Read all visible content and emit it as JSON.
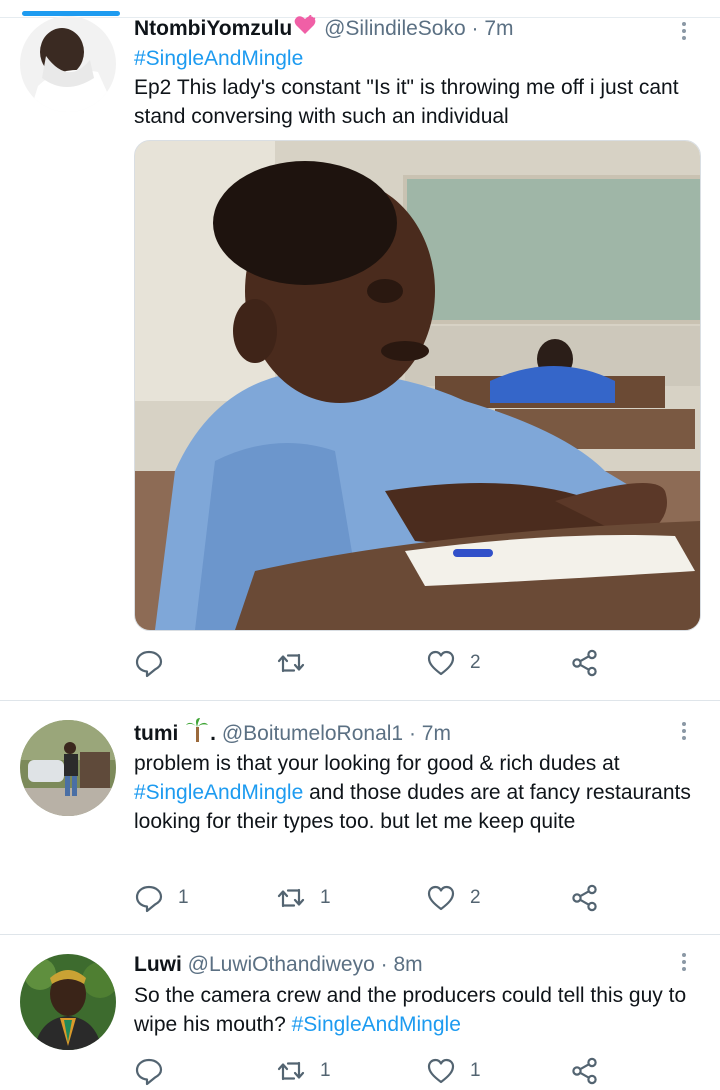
{
  "colors": {
    "accent": "#1d9bf0",
    "text": "#0f1419",
    "muted": "#536471"
  },
  "tweets": [
    {
      "name": "NtombiYomzulu",
      "name_emoji": "pink-heart-icon",
      "handle": "@SilindileSoko",
      "time": "7m",
      "hashtag_line": "#SingleAndMingle",
      "text": "Ep2 This lady's constant \"Is it\" is throwing me off i just cant stand conversing with such an individual",
      "media": "photo of a boy in a blue school shirt at a classroom desk",
      "reply_count": "",
      "retweet_count": "",
      "like_count": "2"
    },
    {
      "name": "tumi",
      "name_emoji": "palm-tree-icon",
      "name_suffix": ".",
      "handle": "@BoitumeloRonal1",
      "time": "7m",
      "text_before": "problem is that your looking for good & rich dudes at ",
      "hashtag": "#SingleAndMingle",
      "text_after": " and those dudes are at fancy restaurants looking for their types too. but let me keep quite",
      "reply_count": "1",
      "retweet_count": "1",
      "like_count": "2"
    },
    {
      "name": "Luwi",
      "handle": "@LuwiOthandiweyo",
      "time": "8m",
      "text_before": "So the camera crew and the producers could tell this guy to wipe his mouth? ",
      "hashtag": "#SingleAndMingle",
      "reply_count": "",
      "retweet_count": "1",
      "like_count": "1"
    }
  ],
  "separator": "·"
}
